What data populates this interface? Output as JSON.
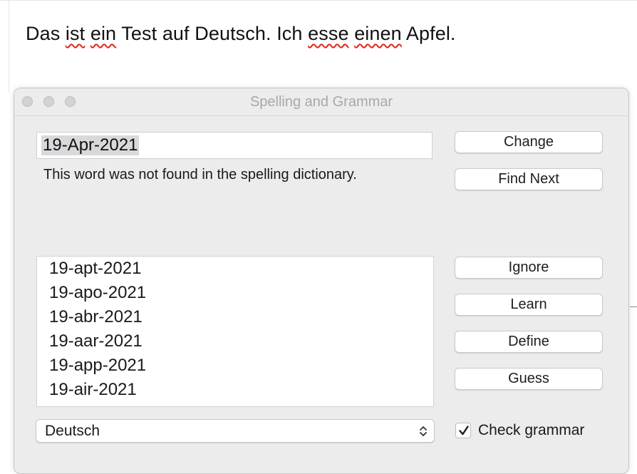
{
  "document": {
    "sentence": [
      {
        "text": "Das ",
        "flag": false
      },
      {
        "text": "ist",
        "flag": true
      },
      {
        "text": " ",
        "flag": false
      },
      {
        "text": "ein",
        "flag": true
      },
      {
        "text": " Test auf Deutsch. Ich ",
        "flag": false
      },
      {
        "text": "esse",
        "flag": true
      },
      {
        "text": " ",
        "flag": false
      },
      {
        "text": "einen",
        "flag": true
      },
      {
        "text": " Apfel.",
        "flag": false
      }
    ]
  },
  "panel": {
    "title": "Spelling and Grammar",
    "word": "19-Apr-2021",
    "message": "This word was not found in the spelling dictionary.",
    "suggestions": [
      "19-apt-2021",
      "19-apo-2021",
      "19-abr-2021",
      "19-aar-2021",
      "19-app-2021",
      "19-air-2021"
    ],
    "buttons": {
      "change": "Change",
      "find_next": "Find Next",
      "ignore": "Ignore",
      "learn": "Learn",
      "define": "Define",
      "guess": "Guess"
    },
    "language": "Deutsch",
    "check_grammar_label": "Check grammar",
    "check_grammar_checked": true
  },
  "colors": {
    "misspelling_underline": "#e0251b",
    "panel_background": "#ececed"
  },
  "icons": {
    "traffic_lights": [
      "close-icon",
      "minimize-icon",
      "zoom-icon"
    ],
    "select": "up-down-chevron-icon",
    "checkbox": "checkmark-icon"
  }
}
